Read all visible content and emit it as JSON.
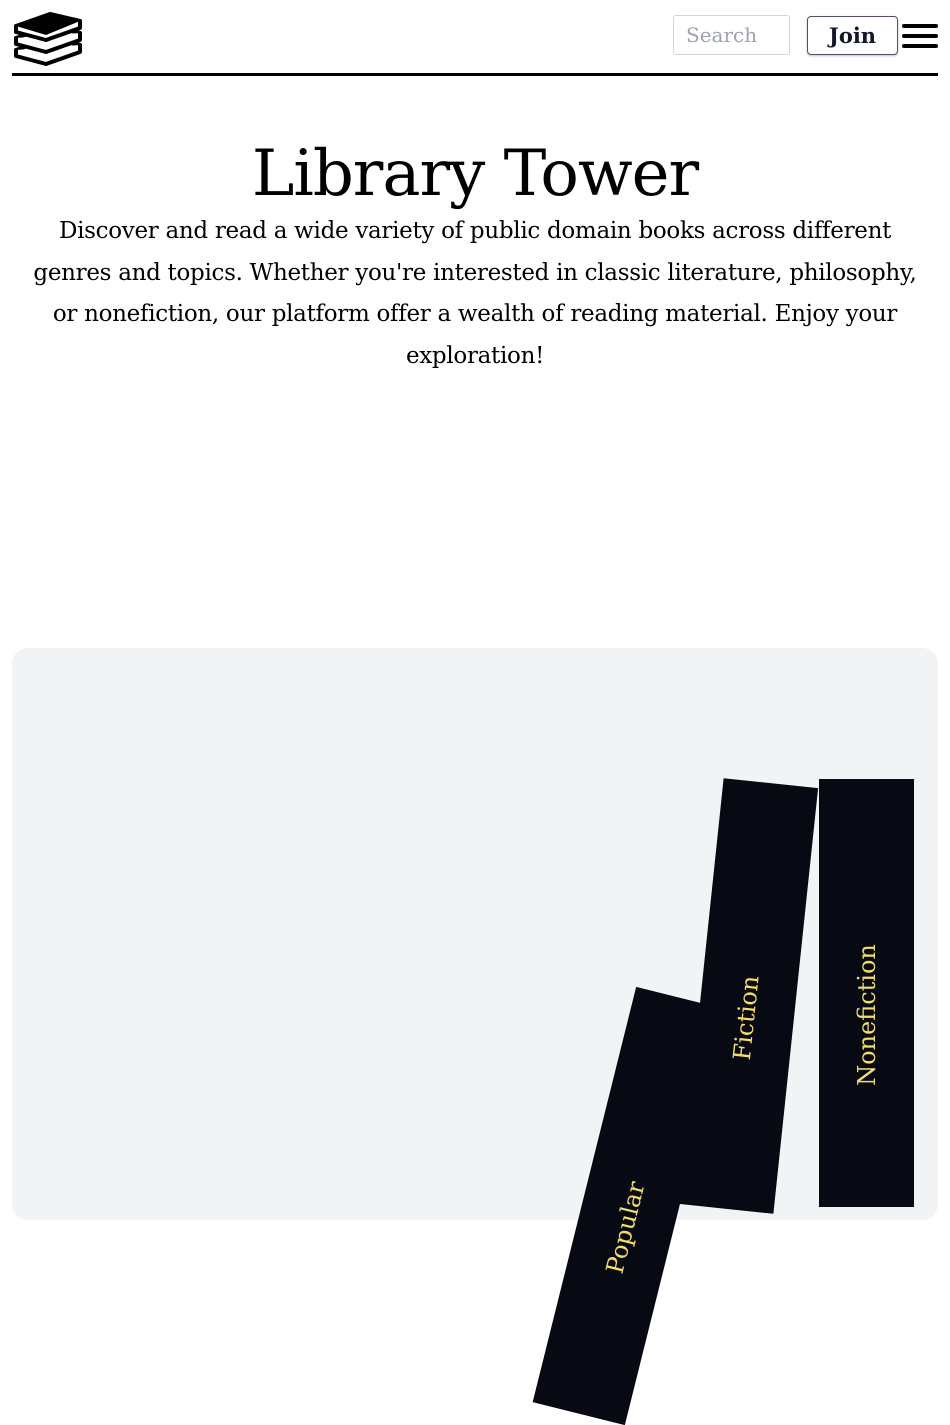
{
  "header": {
    "logo_icon": "book-stack-icon",
    "search": {
      "placeholder": "Search",
      "value": ""
    },
    "join_label": "Join",
    "menu_icon": "hamburger-menu-icon"
  },
  "hero": {
    "title": "Library Tower",
    "description": "Discover and read a wide variety of public domain books across different genres and topics. Whether you're interested in classic literature, philosophy, or nonefiction, our platform offer a wealth of reading material. Enjoy your exploration!"
  },
  "shelf": {
    "books": [
      {
        "label": "Popular"
      },
      {
        "label": "Fiction"
      },
      {
        "label": "Nonefiction"
      }
    ]
  },
  "colors": {
    "book_spine": "#070a12",
    "book_label": "#f4dd6a",
    "shelf_background": "#f2f3f5",
    "header_rule": "#000000"
  }
}
